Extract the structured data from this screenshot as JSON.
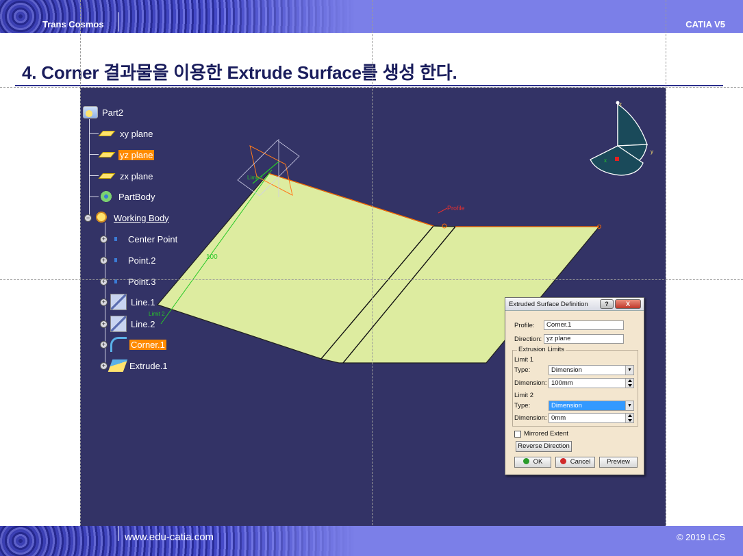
{
  "header": {
    "brand": "Trans Cosmos",
    "product": "CATIA V5"
  },
  "title": "4. Corner 결과물을 이용한 Extrude Surface를 생성 한다.",
  "tree": {
    "root": "Part2",
    "items": [
      {
        "label": "xy plane"
      },
      {
        "label": "yz plane"
      },
      {
        "label": "zx plane"
      },
      {
        "label": "PartBody"
      },
      {
        "label": "Working Body"
      },
      {
        "label": "Center Point"
      },
      {
        "label": "Point.2"
      },
      {
        "label": "Point.3"
      },
      {
        "label": "Line.1"
      },
      {
        "label": "Line.2"
      },
      {
        "label": "Corner.1"
      },
      {
        "label": "Extrude.1"
      }
    ]
  },
  "viewport": {
    "annotations": {
      "profile": "Profile",
      "dim": "100",
      "limit1": "Limit 1",
      "limit2": "Limit 2"
    },
    "compass": {
      "x": "x",
      "y": "y",
      "z": "z"
    }
  },
  "dialog": {
    "title": "Extruded Surface Definition",
    "help_btn": "?",
    "close_btn": "X",
    "profile_label": "Profile:",
    "profile_value": "Corner.1",
    "direction_label": "Direction:",
    "direction_value": "yz plane",
    "group_title": "Extrusion Limits",
    "limit1_title": "Limit 1",
    "limit1_type_label": "Type:",
    "limit1_type_value": "Dimension",
    "limit1_dim_label": "Dimension:",
    "limit1_dim_value": "100mm",
    "limit2_title": "Limit 2",
    "limit2_type_label": "Type:",
    "limit2_type_value": "Dimension",
    "limit2_dim_label": "Dimension:",
    "limit2_dim_value": "0mm",
    "mirrored_label": "Mirrored Extent",
    "mirrored_checked": false,
    "reverse_btn": "Reverse Direction",
    "ok_btn": "OK",
    "cancel_btn": "Cancel",
    "preview_btn": "Preview"
  },
  "footer": {
    "site": "www.edu-catia.com",
    "copyright": "© 2019 LCS"
  },
  "colors": {
    "header_bg": "#7b7fe8",
    "viewport_bg": "#333366",
    "surface": "#ddeca0",
    "selection": "#ff8a00",
    "title_text": "#1a1d5c"
  }
}
